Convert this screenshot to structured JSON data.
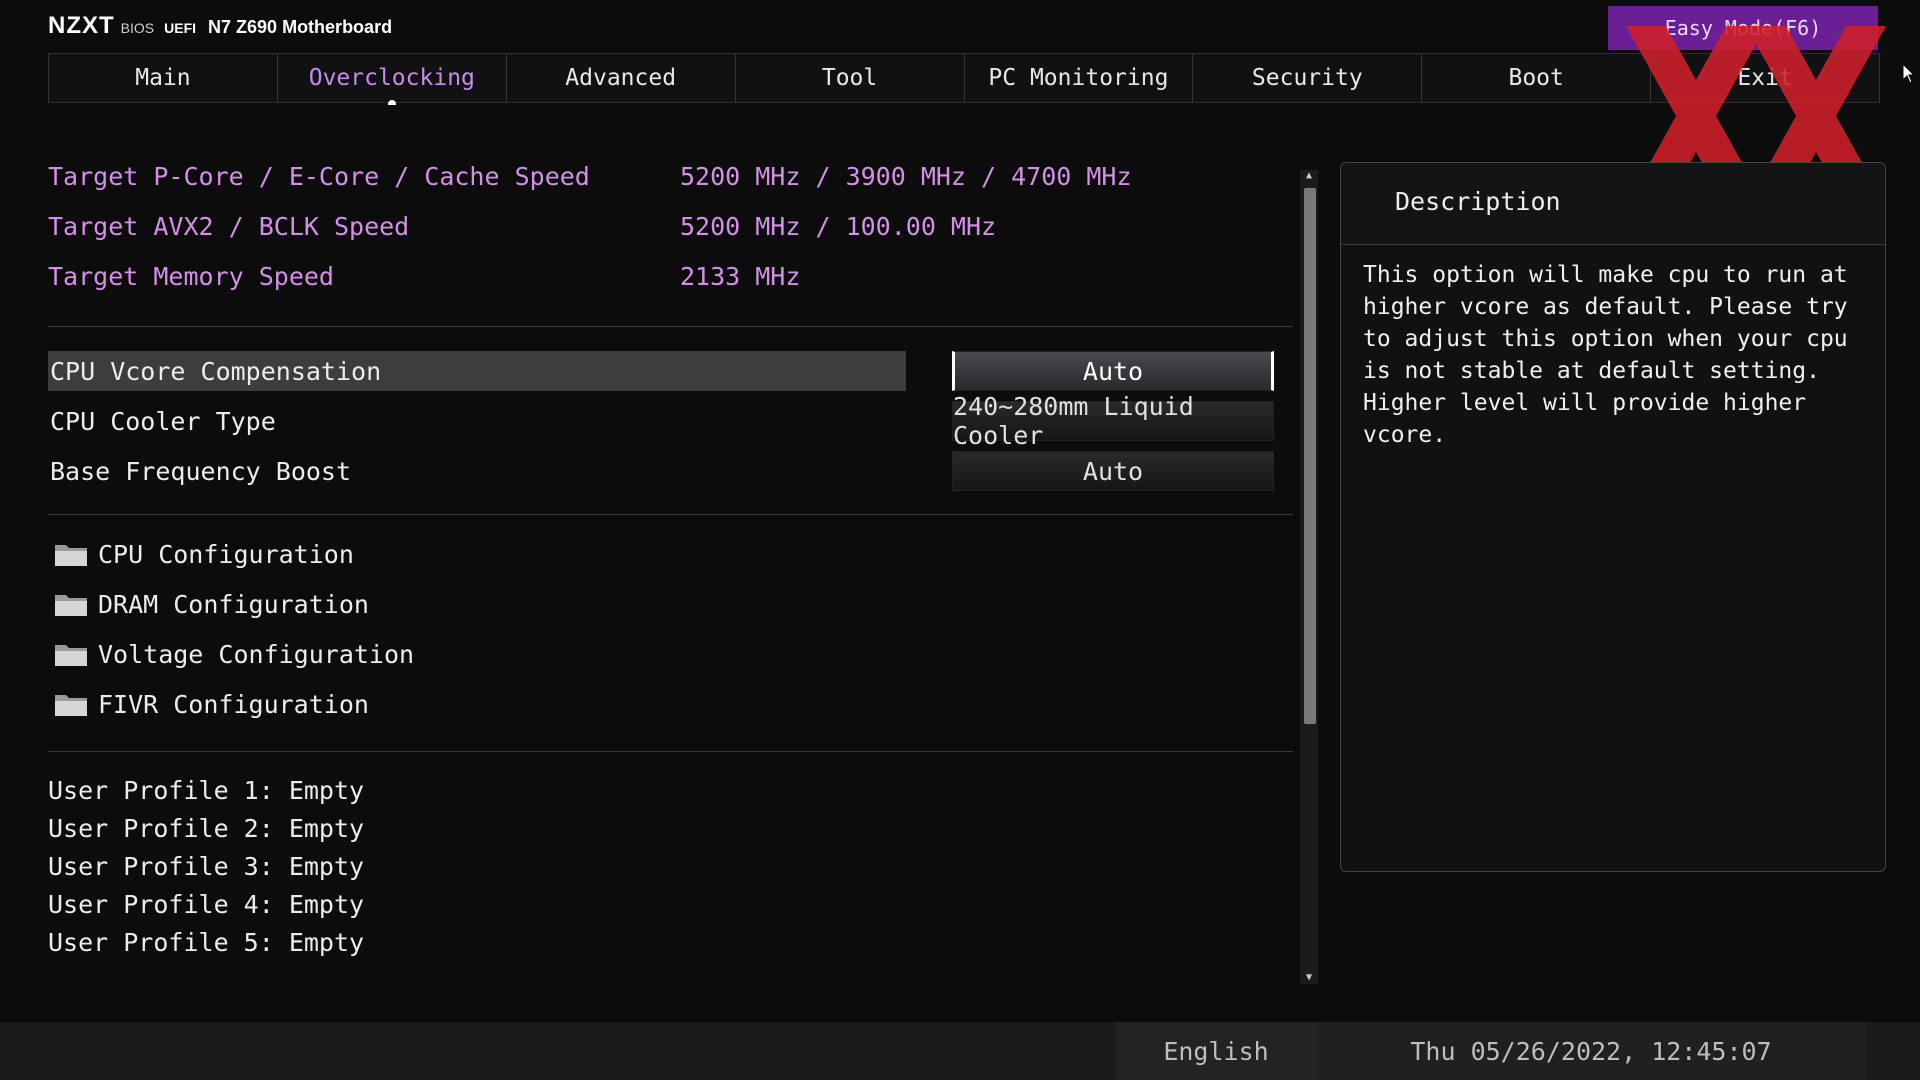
{
  "header": {
    "logo": "NZXT",
    "bios_label": "BIOS",
    "uefi_label": "UEFI",
    "model": "N7 Z690 Motherboard",
    "easy_mode": "Easy Mode(F6)"
  },
  "tabs": [
    {
      "label": "Main",
      "active": false
    },
    {
      "label": "Overclocking",
      "active": true
    },
    {
      "label": "Advanced",
      "active": false
    },
    {
      "label": "Tool",
      "active": false
    },
    {
      "label": "PC Monitoring",
      "active": false
    },
    {
      "label": "Security",
      "active": false
    },
    {
      "label": "Boot",
      "active": false
    },
    {
      "label": "Exit",
      "active": false
    }
  ],
  "targets": [
    {
      "label": "Target P-Core / E-Core / Cache Speed",
      "value": "5200 MHz / 3900 MHz / 4700 MHz"
    },
    {
      "label": "Target AVX2 / BCLK Speed",
      "value": "5200 MHz / 100.00 MHz"
    },
    {
      "label": "Target Memory Speed",
      "value": "2133 MHz"
    }
  ],
  "settings": [
    {
      "label": "CPU Vcore Compensation",
      "value": "Auto",
      "selected": true
    },
    {
      "label": "CPU Cooler Type",
      "value": "240~280mm Liquid Cooler",
      "selected": false
    },
    {
      "label": "Base Frequency Boost",
      "value": "Auto",
      "selected": false
    }
  ],
  "submenus": [
    {
      "label": "CPU Configuration",
      "icon": "folder-icon"
    },
    {
      "label": "DRAM Configuration",
      "icon": "folder-icon"
    },
    {
      "label": "Voltage Configuration",
      "icon": "folder-icon"
    },
    {
      "label": "FIVR Configuration",
      "icon": "folder-icon"
    }
  ],
  "profiles": [
    "User Profile 1: Empty",
    "User Profile 2: Empty",
    "User Profile 3: Empty",
    "User Profile 4: Empty",
    "User Profile 5: Empty"
  ],
  "description": {
    "title": "Description",
    "text": "This option will make cpu to run at\nhigher vcore as default. Please try\nto adjust this option when your cpu\nis not stable at default setting.\nHigher level will provide higher\nvcore."
  },
  "status": {
    "language": "English",
    "datetime": "Thu 05/26/2022, 12:45:07"
  },
  "colors": {
    "accent_purple": "#c98ce8",
    "target_text": "#d48fe6",
    "easy_mode_bg": "#6b1f96",
    "watermark_red": "#d0202a"
  }
}
